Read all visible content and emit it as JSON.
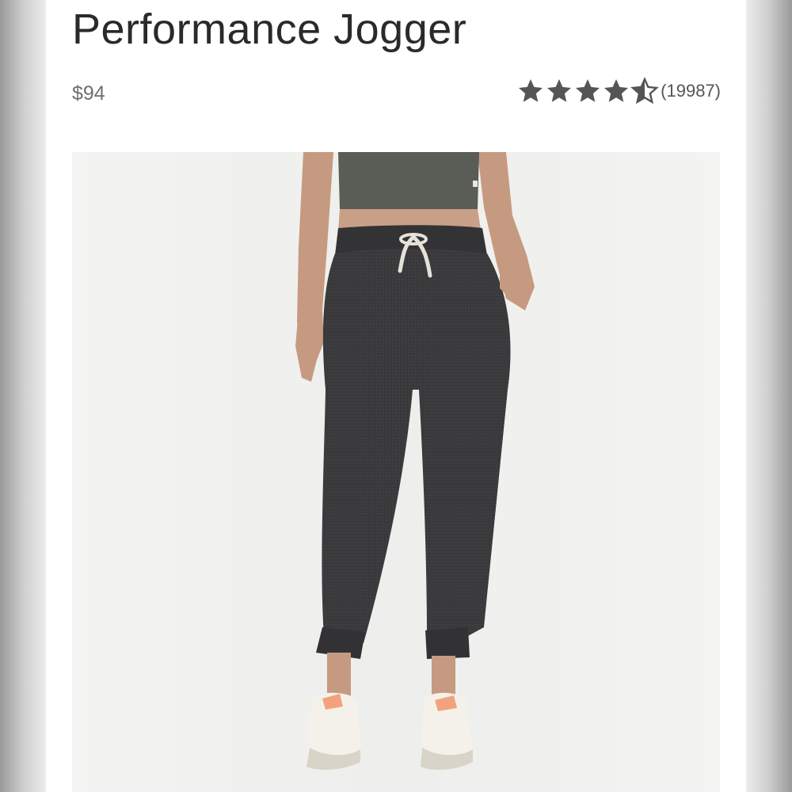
{
  "product": {
    "title": "Performance Jogger",
    "price": "$94",
    "rating": {
      "value": 4.5,
      "max": 5,
      "review_count": "(19987)",
      "star_color": "#555555"
    },
    "image": {
      "subject": "model-wearing-charcoal-joggers"
    }
  },
  "colors": {
    "page_background": "#ececec",
    "card_background": "#ffffff",
    "title_text": "#2a2a2a",
    "price_text": "#6e6e6e",
    "jogger": "#3a3a3c",
    "top": "#5a5d55",
    "image_background": "#f1f1ef"
  }
}
